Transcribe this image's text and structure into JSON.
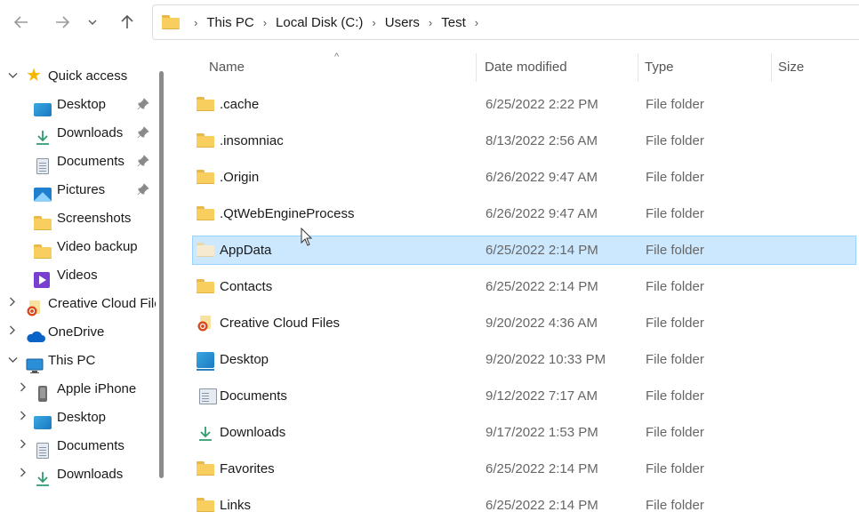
{
  "breadcrumb": [
    "This PC",
    "Local Disk (C:)",
    "Users",
    "Test"
  ],
  "nav": [
    {
      "label": "Quick access",
      "icon": "star-icon",
      "expand": "down",
      "indent": 0,
      "pinned": false
    },
    {
      "label": "Desktop",
      "icon": "desktop-icon",
      "expand": "none",
      "indent": 1,
      "pinned": true
    },
    {
      "label": "Downloads",
      "icon": "download-icon",
      "expand": "none",
      "indent": 1,
      "pinned": true
    },
    {
      "label": "Documents",
      "icon": "document-icon",
      "expand": "none",
      "indent": 1,
      "pinned": true
    },
    {
      "label": "Pictures",
      "icon": "pictures-icon",
      "expand": "none",
      "indent": 1,
      "pinned": true
    },
    {
      "label": "Screenshots",
      "icon": "folder-icon",
      "expand": "none",
      "indent": 1,
      "pinned": false
    },
    {
      "label": "Video backup",
      "icon": "folder-icon",
      "expand": "none",
      "indent": 1,
      "pinned": false
    },
    {
      "label": "Videos",
      "icon": "videos-icon",
      "expand": "none",
      "indent": 1,
      "pinned": false
    },
    {
      "label": "Creative Cloud Files",
      "icon": "creative-cloud-icon",
      "expand": "right",
      "indent": 0,
      "pinned": false
    },
    {
      "label": "OneDrive",
      "icon": "onedrive-icon",
      "expand": "right",
      "indent": 0,
      "pinned": false
    },
    {
      "label": "This PC",
      "icon": "pc-icon",
      "expand": "down",
      "indent": 0,
      "pinned": false
    },
    {
      "label": "Apple iPhone",
      "icon": "phone-icon",
      "expand": "right",
      "indent": 1,
      "pinned": false
    },
    {
      "label": "Desktop",
      "icon": "desktop-icon",
      "expand": "right",
      "indent": 1,
      "pinned": false
    },
    {
      "label": "Documents",
      "icon": "document-icon",
      "expand": "right",
      "indent": 1,
      "pinned": false
    },
    {
      "label": "Downloads",
      "icon": "download-icon",
      "expand": "right",
      "indent": 1,
      "pinned": false
    }
  ],
  "columns": {
    "name": "Name",
    "date": "Date modified",
    "type": "Type",
    "size": "Size"
  },
  "files": [
    {
      "name": ".cache",
      "date": "6/25/2022 2:22 PM",
      "type": "File folder",
      "icon": "folder-icon",
      "selected": false
    },
    {
      "name": ".insomniac",
      "date": "8/13/2022 2:56 AM",
      "type": "File folder",
      "icon": "folder-icon",
      "selected": false
    },
    {
      "name": ".Origin",
      "date": "6/26/2022 9:47 AM",
      "type": "File folder",
      "icon": "folder-icon",
      "selected": false
    },
    {
      "name": ".QtWebEngineProcess",
      "date": "6/26/2022 9:47 AM",
      "type": "File folder",
      "icon": "folder-icon",
      "selected": false
    },
    {
      "name": "AppData",
      "date": "6/25/2022 2:14 PM",
      "type": "File folder",
      "icon": "folder-pale-icon",
      "selected": true
    },
    {
      "name": "Contacts",
      "date": "6/25/2022 2:14 PM",
      "type": "File folder",
      "icon": "folder-icon",
      "selected": false
    },
    {
      "name": "Creative Cloud Files",
      "date": "9/20/2022 4:36 AM",
      "type": "File folder",
      "icon": "creative-cloud-icon",
      "selected": false
    },
    {
      "name": "Desktop",
      "date": "9/20/2022 10:33 PM",
      "type": "File folder",
      "icon": "desktop-icon",
      "selected": false
    },
    {
      "name": "Documents",
      "date": "9/12/2022 7:17 AM",
      "type": "File folder",
      "icon": "document-icon",
      "selected": false
    },
    {
      "name": "Downloads",
      "date": "9/17/2022 1:53 PM",
      "type": "File folder",
      "icon": "download-icon",
      "selected": false
    },
    {
      "name": "Favorites",
      "date": "6/25/2022 2:14 PM",
      "type": "File folder",
      "icon": "folder-icon",
      "selected": false
    },
    {
      "name": "Links",
      "date": "6/25/2022 2:14 PM",
      "type": "File folder",
      "icon": "folder-icon",
      "selected": false
    }
  ]
}
